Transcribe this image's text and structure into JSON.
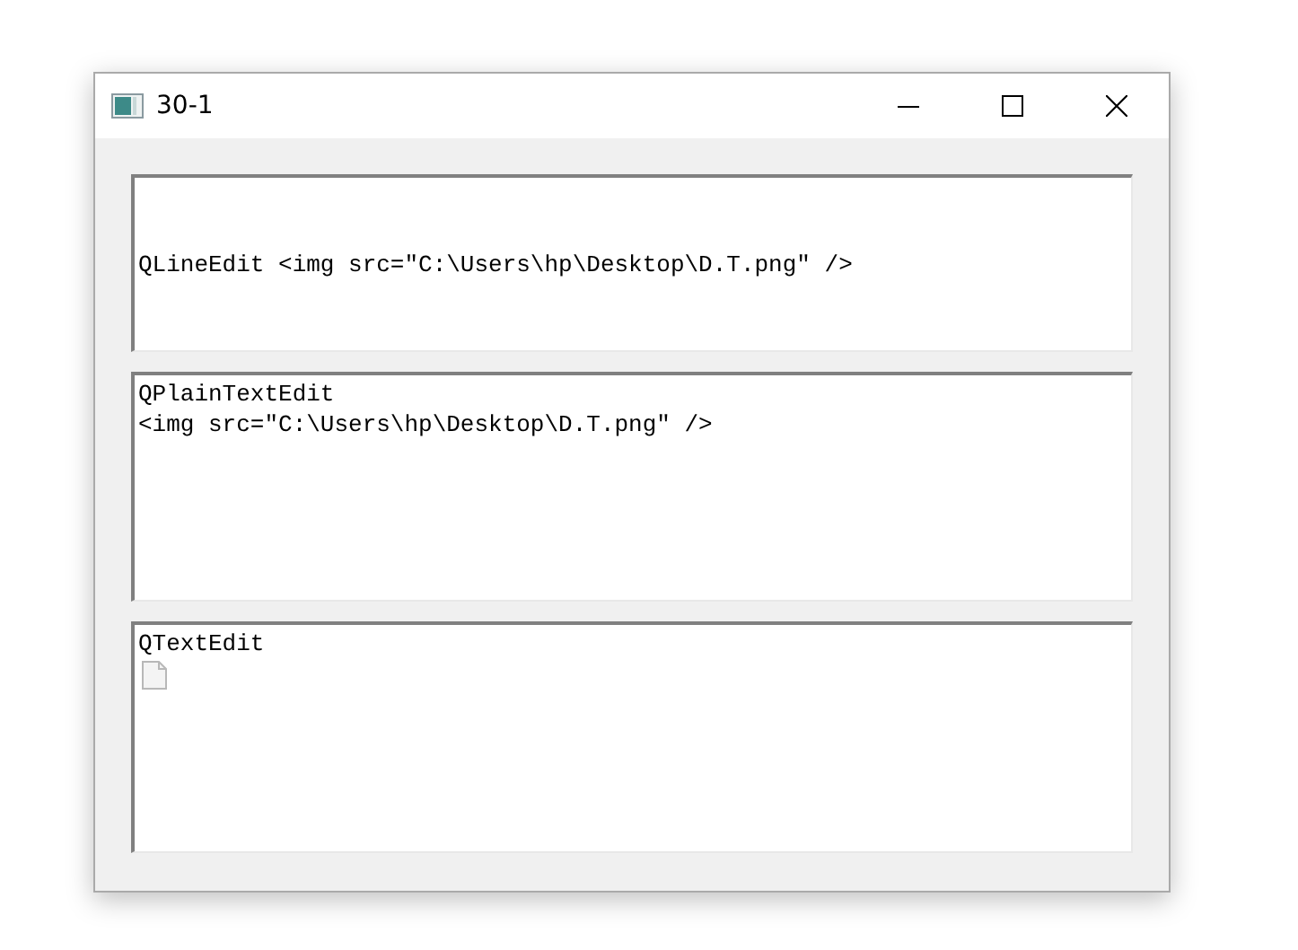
{
  "window": {
    "title": "30-1"
  },
  "fields": [
    {
      "kind": "line",
      "value": "QLineEdit <img src=\"C:\\Users\\hp\\Desktop\\D.T.png\" />"
    },
    {
      "kind": "plain",
      "value": "QPlainTextEdit\n<img src=\"C:\\Users\\hp\\Desktop\\D.T.png\" />"
    },
    {
      "kind": "rich",
      "value": "QTextEdit",
      "broken_image": true
    }
  ]
}
